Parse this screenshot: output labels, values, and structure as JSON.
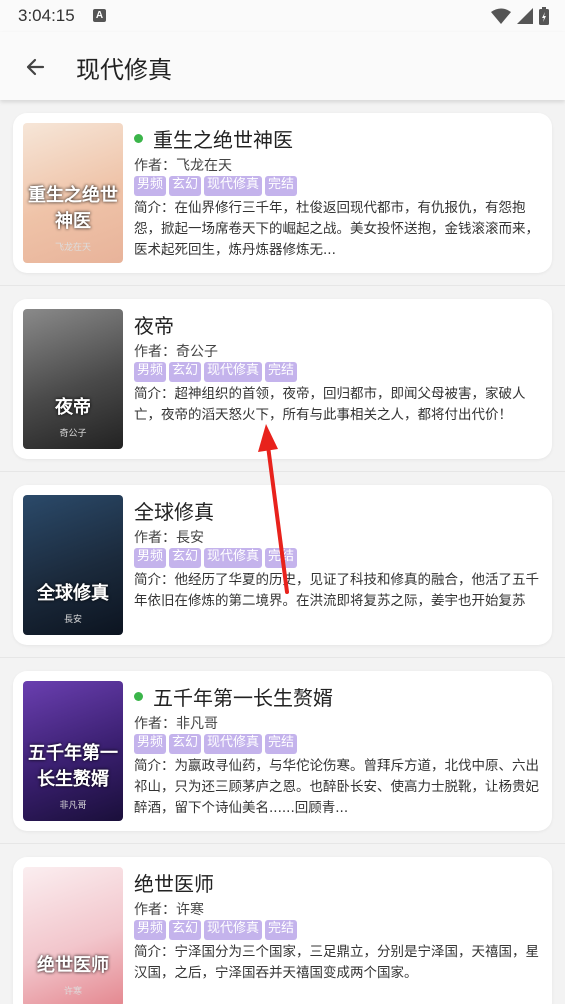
{
  "status": {
    "time": "3:04:15",
    "a_icon": "A"
  },
  "header": {
    "title": "现代修真"
  },
  "author_prefix": "作者：",
  "books": [
    {
      "title": "重生之绝世神医",
      "author": "飞龙在天",
      "dot": true,
      "tags": [
        "男频",
        "玄幻",
        "现代修真",
        "完结"
      ],
      "desc": "简介：在仙界修行三千年，杜俊返回现代都市，有仇报仇，有怨抱怨，掀起一场席卷天下的崛起之战。美女投怀送抱，金钱滚滚而来，医术起死回生，炼丹炼器修炼无...",
      "cover_title": "重生之绝世神医",
      "cover_author": "飞龙在天",
      "cover_colors": [
        "#f6e6d8",
        "#efc3a8",
        "#e8b39a"
      ]
    },
    {
      "title": "夜帝",
      "author": "奇公子",
      "dot": false,
      "tags": [
        "男频",
        "玄幻",
        "现代修真",
        "完结"
      ],
      "desc": "简介：超神组织的首领，夜帝，回归都市，即闻父母被害，家破人亡，夜帝的滔天怒火下，所有与此事相关之人，都将付出代价！",
      "cover_title": "夜帝",
      "cover_author": "奇公子",
      "cover_colors": [
        "#8a8a8a",
        "#4a4a4a",
        "#222222"
      ]
    },
    {
      "title": "全球修真",
      "author": "長安",
      "dot": false,
      "tags": [
        "男频",
        "玄幻",
        "现代修真",
        "完结"
      ],
      "desc": "简介：他经历了华夏的历史，见证了科技和修真的融合，他活了五千年依旧在修炼的第二境界。在洪流即将复苏之际，姜宇也开始复苏",
      "cover_title": "全球修真",
      "cover_author": "長安",
      "cover_colors": [
        "#2b4a6a",
        "#1b2a3c",
        "#0c1420"
      ]
    },
    {
      "title": "五千年第一长生赘婿",
      "author": "非凡哥",
      "dot": true,
      "tags": [
        "男频",
        "玄幻",
        "现代修真",
        "完结"
      ],
      "desc": "简介：为嬴政寻仙药，与华佗论伤寒。曾拜斥方道，北伐中原、六出祁山，只为还三顾茅庐之恩。也醉卧长安、使高力士脱靴，让杨贵妃醉酒，留下个诗仙美名......回顾青...",
      "cover_title": "五千年第一长生赘婿",
      "cover_author": "非凡哥",
      "cover_colors": [
        "#6a3fb0",
        "#3a1f70",
        "#1a0f3a"
      ]
    },
    {
      "title": "绝世医师",
      "author": "许寒",
      "dot": false,
      "tags": [
        "男频",
        "玄幻",
        "现代修真",
        "完结"
      ],
      "desc": "简介：宁泽国分为三个国家，三足鼎立，分别是宁泽国，天禧国，星汉国，之后，宁泽国吞并天禧国变成两个国家。",
      "cover_title": "绝世医师",
      "cover_author": "许寒",
      "cover_colors": [
        "#fbeef0",
        "#f2c6cc",
        "#e4878f"
      ]
    }
  ],
  "colors": {
    "tag_bg": "#c4b3ec",
    "dot": "#3bb54a",
    "annotation_arrow": "#e8221c"
  }
}
